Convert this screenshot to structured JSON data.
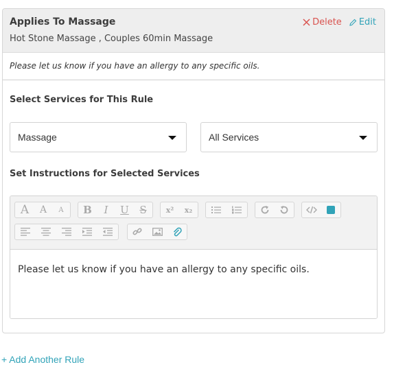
{
  "rule": {
    "title": "Applies To Massage",
    "services": "Hot Stone Massage , Couples 60min Massage",
    "delete_label": "Delete",
    "edit_label": "Edit",
    "instructions_preview": "Please let us know if you have an allergy to any specific oils."
  },
  "services_section": {
    "label": "Select Services for This Rule",
    "category_select": {
      "selected": "Massage"
    },
    "service_select": {
      "selected": "All Services"
    }
  },
  "instructions_section": {
    "label": "Set Instructions for Selected Services",
    "editor_content": "Please let us know if you have an allergy to any specific oils.",
    "toolbar": {
      "row1": [
        [
          "font-size-large-icon",
          "font-size-medium-icon",
          "font-size-small-icon"
        ],
        [
          "bold-icon",
          "italic-icon",
          "underline-icon",
          "strikethrough-icon"
        ],
        [
          "superscript-icon",
          "subscript-icon"
        ],
        [
          "unordered-list-icon",
          "ordered-list-icon"
        ],
        [
          "redo-icon",
          "undo-icon"
        ],
        [
          "code-view-icon",
          "text-color-icon"
        ]
      ],
      "row2": [
        [
          "align-left-icon",
          "align-center-icon",
          "align-right-icon",
          "indent-icon",
          "outdent-icon"
        ],
        [
          "link-icon",
          "image-icon",
          "attachment-icon"
        ]
      ],
      "glyphs": {
        "font_large": "A",
        "font_medium": "A",
        "font_small": "A",
        "bold": "B",
        "italic": "I",
        "underline": "U",
        "strike": "S",
        "superscript": "x²",
        "subscript": "x₂"
      },
      "accent_color": "#31a3b8"
    }
  },
  "footer": {
    "add_rule_label": "+ Add Another Rule"
  },
  "colors": {
    "delete": "#d9534f",
    "link": "#31a3b8",
    "header_bg": "#eeeeee"
  }
}
